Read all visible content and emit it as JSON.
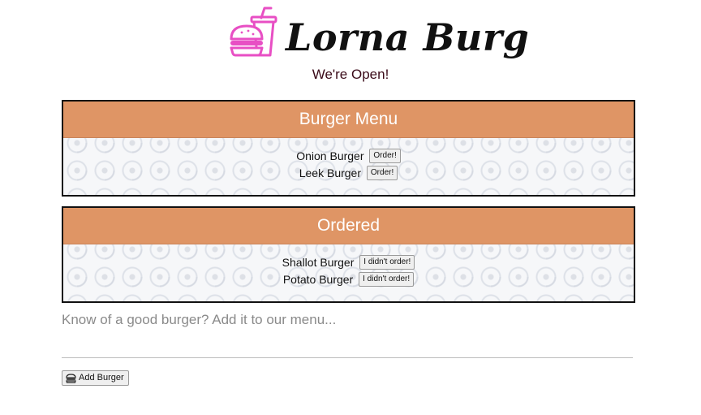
{
  "header": {
    "brand": "Lorna Burg",
    "status": "We're Open!",
    "logo_icon": "burger-and-drink-icon",
    "logo_color": "#e84fc4"
  },
  "menu_panel": {
    "title": "Burger Menu",
    "items": [
      {
        "name": "Onion Burger",
        "action": "Order!"
      },
      {
        "name": "Leek Burger",
        "action": "Order!"
      }
    ]
  },
  "ordered_panel": {
    "title": "Ordered",
    "items": [
      {
        "name": "Shallot Burger",
        "action": "I didn't order!"
      },
      {
        "name": "Potato Burger",
        "action": "I didn't order!"
      }
    ]
  },
  "form": {
    "label": "Know of a good burger? Add it to our menu...",
    "input_value": "",
    "button_label": "Add Burger",
    "button_icon": "burger-icon"
  },
  "colors": {
    "panel_header": "#df9565",
    "status_text": "#3a0a18",
    "accent": "#e84fc4"
  }
}
